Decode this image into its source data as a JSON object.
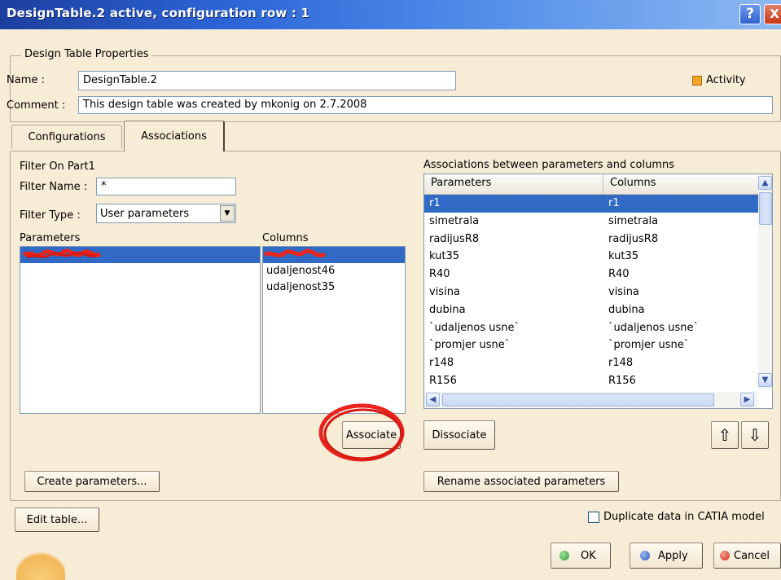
{
  "window": {
    "title": "DesignTable.2 active, configuration row : 1"
  },
  "titlebar": {
    "help": "?",
    "close": "X"
  },
  "properties": {
    "group_label": "Design Table Properties",
    "name_label": "Name :",
    "name_value": "DesignTable.2",
    "comment_label": "Comment :",
    "comment_value": "This design table was created by mkonig on 2.7.2008",
    "activity_label": "Activity"
  },
  "tabs": [
    {
      "label": "Configurations"
    },
    {
      "label": "Associations"
    }
  ],
  "filter": {
    "title": "Filter On Part1",
    "name_label": "Filter Name :",
    "name_value": "*",
    "type_label": "Filter Type :",
    "type_value": "User parameters"
  },
  "left_lists": {
    "parameters_header": "Parameters",
    "columns_header": "Columns",
    "parameters": [],
    "columns": [
      "udaljenost46",
      "udaljenost35"
    ]
  },
  "associations": {
    "title": "Associations between parameters and columns",
    "headers": {
      "parameters": "Parameters",
      "columns": "Columns"
    },
    "rows": [
      {
        "param": "r1",
        "column": "r1"
      },
      {
        "param": "simetrala",
        "column": "simetrala"
      },
      {
        "param": "radijusR8",
        "column": "radijusR8"
      },
      {
        "param": "kut35",
        "column": "kut35"
      },
      {
        "param": "R40",
        "column": "R40"
      },
      {
        "param": "visina",
        "column": "visina"
      },
      {
        "param": "dubina",
        "column": "dubina"
      },
      {
        "param": "`udaljenos usne`",
        "column": "`udaljenos usne`"
      },
      {
        "param": "`promjer usne`",
        "column": "`promjer usne`"
      },
      {
        "param": "r148",
        "column": "r148"
      },
      {
        "param": "R156",
        "column": "R156"
      }
    ]
  },
  "buttons": {
    "associate": "Associate",
    "dissociate": "Dissociate",
    "create_parameters": "Create parameters...",
    "rename_associated": "Rename associated parameters",
    "edit_table": "Edit table...",
    "ok": "OK",
    "apply": "Apply",
    "cancel": "Cancel"
  },
  "options": {
    "duplicate_label": "Duplicate data in CATIA model"
  },
  "colors": {
    "background": "#f7ecd6",
    "selection": "#316ac5",
    "annotation_red": "#e8241c",
    "ok_green": "#2e9c2e",
    "apply_blue": "#2b56b8",
    "cancel_red": "#d02a1a"
  }
}
